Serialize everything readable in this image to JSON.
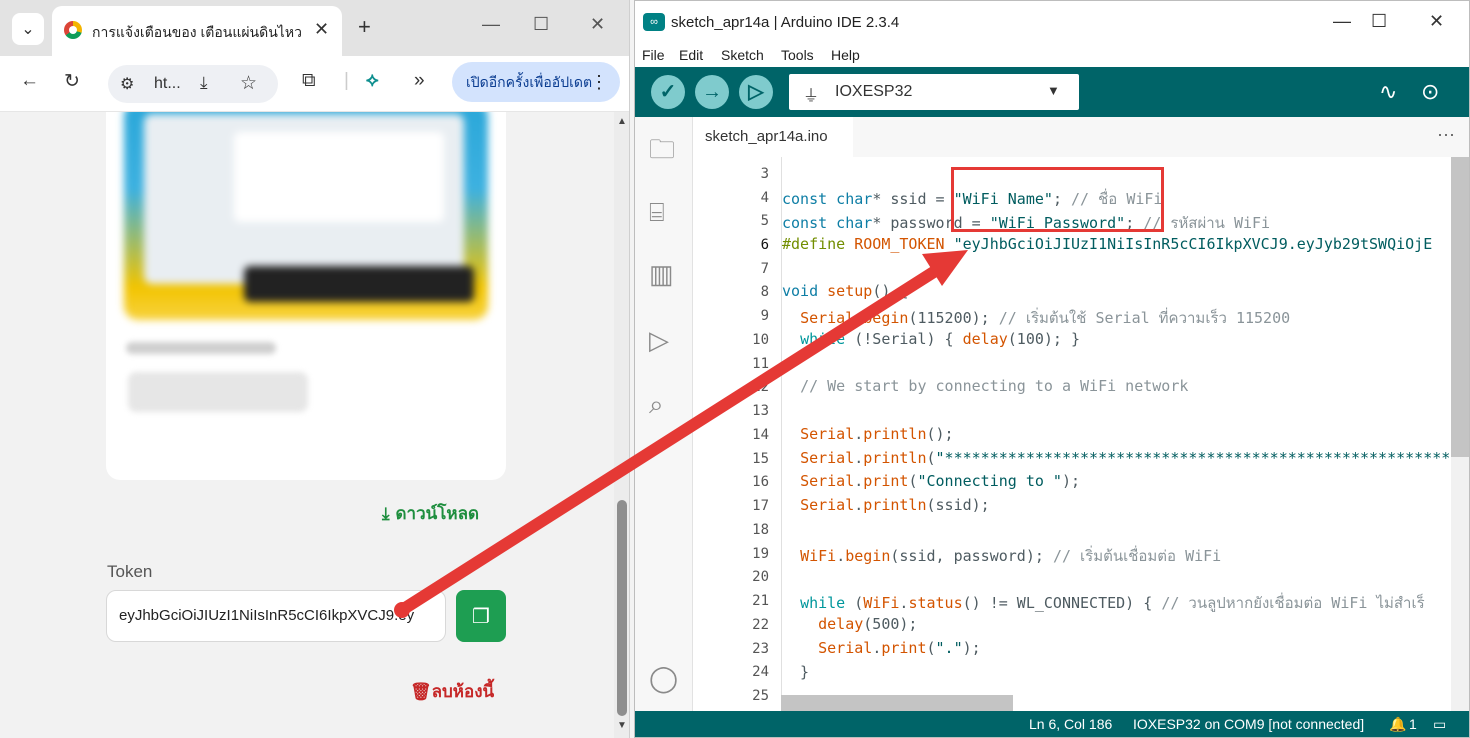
{
  "browser": {
    "tab_title": "การแจ้งเตือนของ เตือนแผ่นดินไหว - A",
    "url_short": "ht...",
    "update_button": "เปิดอีกครั้งเพื่ออัปเดต",
    "page": {
      "download_label": "ดาวน์โหลด",
      "token_label": "Token",
      "token_value": "eyJhbGciOiJIUzI1NiIsInR5cCI6IkpXVCJ9.ey",
      "delete_room_label": "ลบห้องนี้"
    }
  },
  "ide": {
    "window_title": "sketch_apr14a | Arduino IDE 2.3.4",
    "menu": [
      "File",
      "Edit",
      "Sketch",
      "Tools",
      "Help"
    ],
    "board": "IOXESP32",
    "file_tab": "sketch_apr14a.ino",
    "line_numbers": [
      "3",
      "4",
      "5",
      "6",
      "7",
      "8",
      "9",
      "10",
      "11",
      "12",
      "13",
      "14",
      "15",
      "16",
      "17",
      "18",
      "19",
      "20",
      "21",
      "22",
      "23",
      "24",
      "25"
    ],
    "status": {
      "cursor": "Ln 6, Col 186",
      "board_port": "IOXESP32 on COM9 [not connected]",
      "notifications": "1"
    }
  },
  "colors": {
    "arduino_teal": "#006468",
    "annotation_red": "#e53935",
    "copy_green": "#1e9e52"
  }
}
